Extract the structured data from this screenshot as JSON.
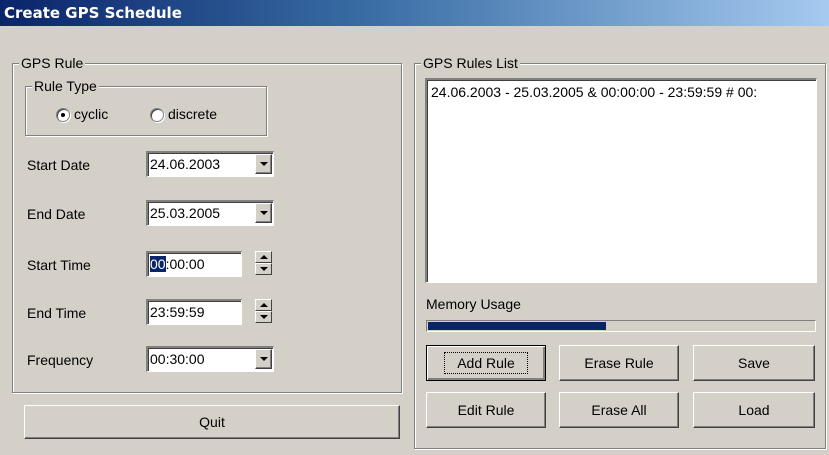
{
  "window": {
    "title": "Create GPS Schedule"
  },
  "gps_rule": {
    "legend": "GPS Rule",
    "rule_type": {
      "legend": "Rule Type",
      "options": [
        {
          "label": "cyclic",
          "checked": true
        },
        {
          "label": "discrete",
          "checked": false
        }
      ]
    },
    "start_date": {
      "label": "Start Date",
      "value": "24.06.2003"
    },
    "end_date": {
      "label": "End Date",
      "value": "25.03.2005"
    },
    "start_time": {
      "label": "Start Time",
      "selected_part": "00",
      "rest": ":00:00"
    },
    "end_time": {
      "label": "End Time",
      "value": "23:59:59"
    },
    "frequency": {
      "label": "Frequency",
      "value": "00:30:00"
    }
  },
  "rules_list": {
    "legend": "GPS Rules List",
    "items": [
      "24.06.2003 - 25.03.2005 & 00:00:00 - 23:59:59 # 00:"
    ]
  },
  "memory": {
    "label": "Memory Usage",
    "usage": 0.46,
    "fill_color": "#0a246a"
  },
  "buttons": {
    "add_rule": "Add Rule",
    "erase_rule": "Erase Rule",
    "save": "Save",
    "edit_rule": "Edit Rule",
    "erase_all": "Erase All",
    "load": "Load",
    "quit": "Quit"
  },
  "colors": {
    "titlebar": "#0a246a",
    "face": "#d4d0c8",
    "selection": "#0a246a"
  }
}
